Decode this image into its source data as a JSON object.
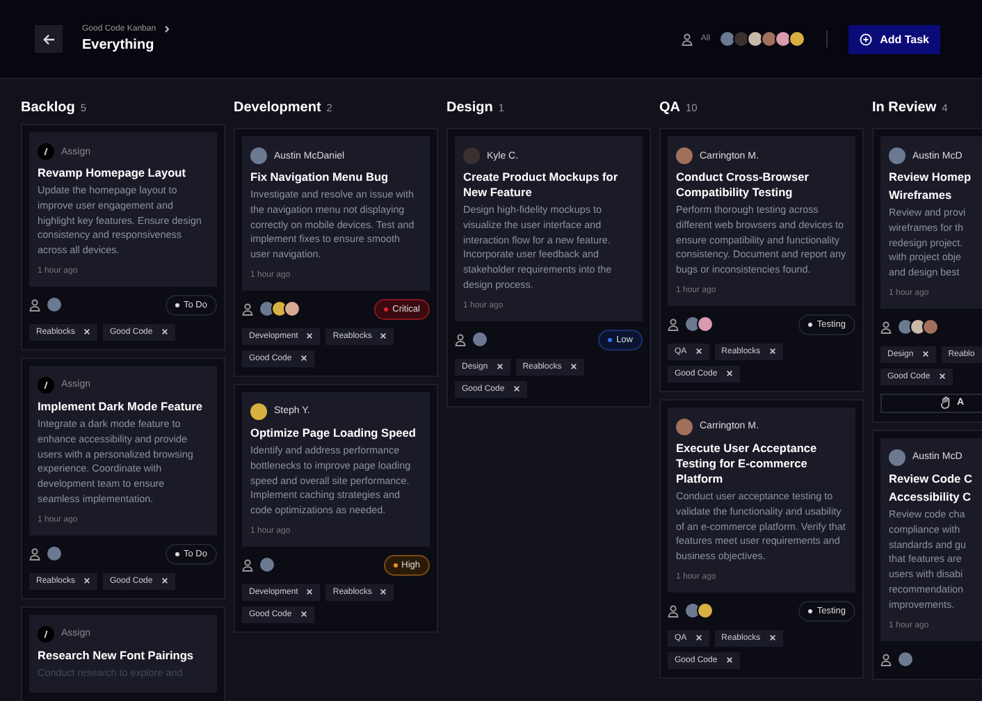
{
  "header": {
    "breadcrumb": "Good Code Kanban",
    "title": "Everything",
    "filter_label": "All",
    "members": [
      {
        "color": "#6b7a90"
      },
      {
        "color": "#3b3030"
      },
      {
        "color": "#c9b9a8"
      },
      {
        "color": "#a0705a"
      },
      {
        "color": "#d99ab0"
      },
      {
        "color": "#d8b040"
      }
    ],
    "add_button": "Add Task"
  },
  "columns": [
    {
      "name": "Backlog",
      "count": "5",
      "cards": [
        {
          "assignee": {
            "name": "Assign",
            "assigned": false
          },
          "title": "Revamp Homepage Layout",
          "description": "Update the homepage layout to improve user engagement and highlight key features. Ensure design consistency and responsiveness across all devices.",
          "time": "1 hour ago",
          "avatars": [
            {
              "color": "#6b7a90"
            }
          ],
          "status": {
            "label": "To Do",
            "kind": "todo"
          },
          "tags": [
            "Reablocks",
            "Good Code"
          ]
        },
        {
          "assignee": {
            "name": "Assign",
            "assigned": false
          },
          "title": "Implement Dark Mode Feature",
          "description": "Integrate a dark mode feature to enhance accessibility and provide users with a personalized browsing experience. Coordinate with development team to ensure seamless implementation.",
          "time": "1 hour ago",
          "avatars": [
            {
              "color": "#6b7a90"
            }
          ],
          "status": {
            "label": "To Do",
            "kind": "todo"
          },
          "tags": [
            "Reablocks",
            "Good Code"
          ]
        },
        {
          "assignee": {
            "name": "Assign",
            "assigned": false
          },
          "title": "Research New Font Pairings",
          "description": "Conduct research to explore and",
          "faded": true
        }
      ]
    },
    {
      "name": "Development",
      "count": "2",
      "cards": [
        {
          "assignee": {
            "name": "Austin McDaniel",
            "assigned": true,
            "color": "#6b7a90"
          },
          "title": "Fix Navigation Menu Bug",
          "description": "Investigate and resolve an issue with the navigation menu not displaying correctly on mobile devices. Test and implement fixes to ensure smooth user navigation.",
          "time": "1 hour ago",
          "avatars": [
            {
              "color": "#6b7a90"
            },
            {
              "color": "#d8b040"
            },
            {
              "color": "#d9a890"
            }
          ],
          "status": {
            "label": "Critical",
            "kind": "critical"
          },
          "tags": [
            "Development",
            "Reablocks",
            "Good Code"
          ]
        },
        {
          "assignee": {
            "name": "Steph Y.",
            "assigned": true,
            "color": "#d8b040"
          },
          "title": "Optimize Page Loading Speed",
          "description": "Identify and address performance bottlenecks to improve page loading speed and overall site performance. Implement caching strategies and code optimizations as needed.",
          "time": "1 hour ago",
          "avatars": [
            {
              "color": "#6b7a90"
            }
          ],
          "status": {
            "label": "High",
            "kind": "high"
          },
          "tags": [
            "Development",
            "Reablocks",
            "Good Code"
          ]
        }
      ]
    },
    {
      "name": "Design",
      "count": "1",
      "cards": [
        {
          "assignee": {
            "name": "Kyle C.",
            "assigned": true,
            "color": "#3b3030"
          },
          "title": "Create Product Mockups for New Feature",
          "description": "Design high-fidelity mockups to visualize the user interface and interaction flow for a new feature. Incorporate user feedback and stakeholder requirements into the design process.",
          "time": "1 hour ago",
          "avatars": [
            {
              "color": "#6b7a90"
            }
          ],
          "status": {
            "label": "Low",
            "kind": "low"
          },
          "tags": [
            "Design",
            "Reablocks",
            "Good Code"
          ]
        }
      ]
    },
    {
      "name": "QA",
      "count": "10",
      "cards": [
        {
          "assignee": {
            "name": "Carrington M.",
            "assigned": true,
            "color": "#a0705a"
          },
          "title": "Conduct Cross-Browser Compatibility Testing",
          "description": "Perform thorough testing across different web browsers and devices to ensure compatibility and functionality consistency. Document and report any bugs or inconsistencies found.",
          "time": "1 hour ago",
          "avatars": [
            {
              "color": "#6b7a90"
            },
            {
              "color": "#d99ab0"
            }
          ],
          "status": {
            "label": "Testing",
            "kind": "testing"
          },
          "tags": [
            "QA",
            "Reablocks",
            "Good Code"
          ]
        },
        {
          "assignee": {
            "name": "Carrington M.",
            "assigned": true,
            "color": "#a0705a"
          },
          "title": "Execute User Acceptance Testing for E-commerce Platform",
          "description": "Conduct user acceptance testing to validate the functionality and usability of an e-commerce platform. Verify that features meet user requirements and business objectives.",
          "time": "1 hour ago",
          "avatars": [
            {
              "color": "#6b7a90"
            },
            {
              "color": "#d8b040"
            }
          ],
          "status": {
            "label": "Testing",
            "kind": "testing"
          },
          "tags": [
            "QA",
            "Reablocks",
            "Good Code"
          ]
        }
      ]
    },
    {
      "name": "In Review",
      "count": "4",
      "cards": [
        {
          "assignee": {
            "name": "Austin McD",
            "assigned": true,
            "color": "#6b7a90"
          },
          "title_lines": [
            "Review Homep",
            "Wireframes"
          ],
          "description_lines": [
            "Review and provi",
            "wireframes for th",
            "redesign project.",
            "with project obje",
            "and design best"
          ],
          "time": "1 hour ago",
          "avatars": [
            {
              "color": "#6b7a90"
            },
            {
              "color": "#c9b9a8"
            },
            {
              "color": "#a0705a"
            }
          ],
          "tags": [
            "Design",
            "Reablo",
            "Good Code"
          ],
          "action": "A"
        },
        {
          "assignee": {
            "name": "Austin McD",
            "assigned": true,
            "color": "#6b7a90"
          },
          "title_lines": [
            "Review Code C",
            "Accessibility C"
          ],
          "description_lines": [
            "Review code cha",
            "compliance with",
            "standards and gu",
            "that features are",
            "users with disabi",
            "recommendation",
            "improvements."
          ],
          "time": "1 hour ago",
          "avatars": [
            {
              "color": "#6b7a90"
            }
          ]
        }
      ]
    }
  ]
}
